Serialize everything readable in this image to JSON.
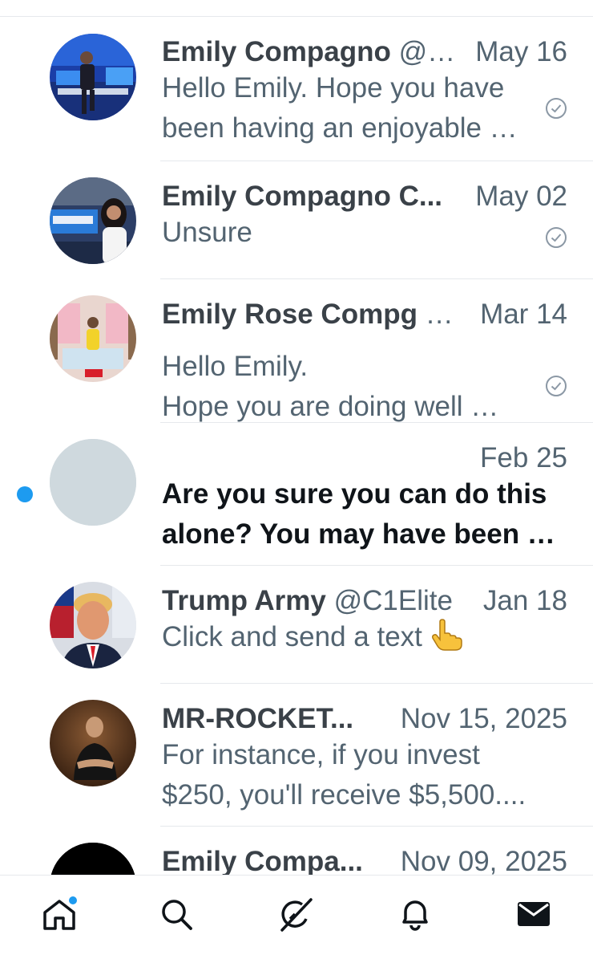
{
  "conversations": [
    {
      "name": "Emily Compagno",
      "handle": "@…",
      "name_ellipsis": "",
      "date": "May 16",
      "preview_lines": [
        "Hello Emily. Hope you have",
        "been having an enjoyable …"
      ],
      "avatar_icon": "avatar-photo-news-studio",
      "read_receipt": true,
      "unread": false
    },
    {
      "name": "Emily Compagno C...",
      "handle": "",
      "name_ellipsis": "",
      "date": "May 02",
      "preview_lines": [
        "Unsure"
      ],
      "avatar_icon": "avatar-photo-news-set",
      "read_receipt": true,
      "unread": false
    },
    {
      "name": "Emily Rose Compg",
      "handle": "",
      "name_ellipsis": " …",
      "date": "Mar 14",
      "preview_lines": [
        "Hello Emily.",
        "Hope you are doing well …"
      ],
      "avatar_icon": "avatar-photo-kitchen-set",
      "read_receipt": true,
      "unread": false
    },
    {
      "name": "",
      "handle": "",
      "name_ellipsis": "",
      "date": "Feb 25",
      "preview_lines": [
        "Are you sure you can do this",
        "alone? You may have been …"
      ],
      "avatar_icon": "avatar-placeholder",
      "read_receipt": false,
      "unread": true
    },
    {
      "name": "Trump Army",
      "handle": "@C1Elite",
      "name_ellipsis": "",
      "date": "Jan 18",
      "preview_lines": [
        "Click and send a text"
      ],
      "preview_emoji": "pointing-hand-emoji",
      "avatar_icon": "avatar-photo-portrait",
      "read_receipt": false,
      "unread": false
    },
    {
      "name": "MR-ROCKET...",
      "handle": "",
      "name_ellipsis": "",
      "date": "Nov 15, 2025",
      "preview_lines": [
        "For instance, if you invest",
        "$250, you'll receive $5,500...."
      ],
      "avatar_icon": "avatar-photo-dark-portrait",
      "read_receipt": false,
      "unread": false
    },
    {
      "name": "Emily Compa...",
      "handle": "",
      "name_ellipsis": "",
      "date": "Nov 09, 2025",
      "preview_lines": [],
      "avatar_icon": "avatar-photo-black",
      "read_receipt": false,
      "unread": false
    }
  ],
  "nav": {
    "items": [
      "home-icon",
      "search-icon",
      "grok-icon",
      "notifications-icon",
      "messages-icon"
    ],
    "home_has_badge": true,
    "active": "messages-icon"
  },
  "colors": {
    "accent": "#1d9bf0",
    "text_primary": "#0f1419",
    "text_secondary": "#536471",
    "divider": "#e6e9ec",
    "placeholder_avatar": "#cfd9de"
  }
}
